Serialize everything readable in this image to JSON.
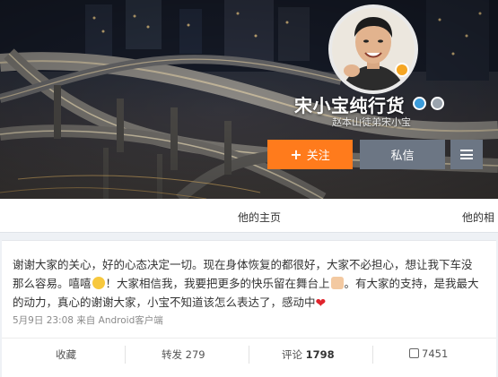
{
  "profile": {
    "name": "宋小宝纯行货",
    "subtitle": "赵本山徒弟宋小宝"
  },
  "buttons": {
    "follow_plus": "+",
    "follow_label": "关注",
    "message_label": "私信"
  },
  "tabs": [
    "他的主页",
    "他的相"
  ],
  "post": {
    "text_1": "谢谢大家的关心，好的心态决定一切。现在身体恢复的都很好，大家不必担心，想让我下车没那么容易。嘻嘻",
    "text_2": "！大家相信我，我要把更多的快乐留在舞台上",
    "text_3": "。有大家的支持，是我最大的动力，真心的谢谢大家，小宝不知道该怎么表达了，感动中",
    "heart": "❤",
    "date": "5月9日 23:08",
    "source": "来自 Android客户端"
  },
  "actions": {
    "favorite_label": "收藏",
    "forward_label": "转发",
    "forward_count": "279",
    "comment_label": "评论",
    "comment_count": "1798",
    "like_count": "7451"
  },
  "colors": {
    "follow_button": "#ff7b1c",
    "secondary_button": "#6c7684",
    "heart": "#e0242c"
  }
}
